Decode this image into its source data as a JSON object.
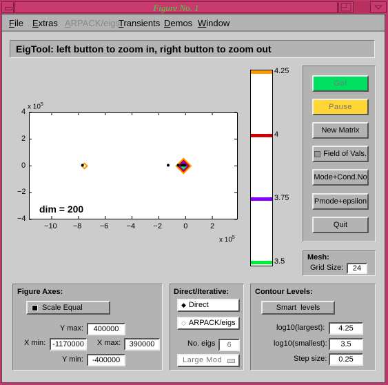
{
  "window": {
    "title": "Figure No. 1"
  },
  "menubar": {
    "items": [
      {
        "label": "File",
        "enabled": true
      },
      {
        "label": "Extras",
        "enabled": true
      },
      {
        "label": "ARPACK/eigs",
        "enabled": false
      },
      {
        "label": "Transients",
        "enabled": true
      },
      {
        "label": "Demos",
        "enabled": true
      },
      {
        "label": "Window",
        "enabled": true
      }
    ]
  },
  "status": {
    "text": "EigTool: left button to zoom in, right button to zoom out"
  },
  "chart_data": {
    "type": "contour",
    "title": "",
    "annotation": "dim = 200",
    "xlabel": "",
    "ylabel": "",
    "x_exponent_label": "x 10",
    "x_exponent": "5",
    "y_exponent_label": "x 10",
    "y_exponent": "5",
    "xlim": [
      -11.7,
      3.9
    ],
    "ylim": [
      -4,
      4
    ],
    "xticks": [
      -10,
      -8,
      -6,
      -4,
      -2,
      0,
      2
    ],
    "yticks": [
      -4,
      -2,
      0,
      2,
      4
    ],
    "eigenvalues": [
      {
        "x": -7.7,
        "y": 0.05
      },
      {
        "x": -1.3,
        "y": 0.05
      },
      {
        "x": -0.55,
        "y": 0.05
      },
      {
        "x": -0.3,
        "y": 0.05
      },
      {
        "x": -0.15,
        "y": 0.05
      },
      {
        "x": -0.05,
        "y": 0.05
      }
    ],
    "contours": [
      {
        "level": 4.25,
        "color": "#ff9900",
        "centers": [
          {
            "x": -7.55,
            "y": 0,
            "r": 0.2
          },
          {
            "x": -0.15,
            "y": 0,
            "r": 0.55
          }
        ]
      },
      {
        "level": 4.0,
        "color": "#cc0000",
        "centers": [
          {
            "x": -0.15,
            "y": 0,
            "r": 0.4
          }
        ]
      },
      {
        "level": 3.75,
        "color": "#8800ff",
        "centers": [
          {
            "x": -0.15,
            "y": 0,
            "r": 0.28
          }
        ]
      },
      {
        "level": 3.5,
        "color": "#00ff44",
        "centers": [
          {
            "x": -0.15,
            "y": -0.05,
            "r": 0.15
          }
        ]
      }
    ]
  },
  "colorbar": {
    "levels": [
      {
        "value": 4.25,
        "label": "4.25",
        "color": "#ff9900"
      },
      {
        "value": 4.0,
        "label": "4",
        "color": "#cc0000"
      },
      {
        "value": 3.75,
        "label": "3.75",
        "color": "#8800ff"
      },
      {
        "value": 3.5,
        "label": "3.5",
        "color": "#00ee33"
      }
    ],
    "range": [
      3.5,
      4.25
    ]
  },
  "right_panel": {
    "go_label": "Go!",
    "pause_label": "Pause",
    "new_matrix_label": "New Matrix",
    "field_of_vals_label": "Field of Vals.",
    "field_of_vals_checked": false,
    "mode_cond_label": "Mode+Cond.No",
    "pmode_label": "Pmode+epsilon",
    "quit_label": "Quit",
    "go_color": "#00e060",
    "pause_color": "#ffd633"
  },
  "mesh": {
    "title": "Mesh:",
    "grid_size_label": "Grid Size:",
    "grid_size": "24"
  },
  "figure_axes": {
    "title": "Figure Axes:",
    "scale_equal_label": "Scale Equal",
    "scale_equal_checked": true,
    "ymax_label": "Y max:",
    "ymax": "400000",
    "xmin_label": "X min:",
    "xmin": "-1170000",
    "xmax_label": "X max:",
    "xmax": "390000",
    "ymin_label": "Y min:",
    "ymin": "-400000"
  },
  "direct_iterative": {
    "title": "Direct/Iterative:",
    "direct_label": "Direct",
    "direct_selected": true,
    "arpack_label": "ARPACK/eigs",
    "no_eigs_label": "No. eigs",
    "no_eigs": "6",
    "which_label": "Large Mod"
  },
  "contour_levels": {
    "title": "Contour Levels:",
    "smart_levels_label": "Smart  levels",
    "largest_label": "log10(largest):",
    "largest": "4.25",
    "smallest_label": "log10(smallest):",
    "smallest": "3.5",
    "step_label": "Step size:",
    "step": "0.25"
  }
}
